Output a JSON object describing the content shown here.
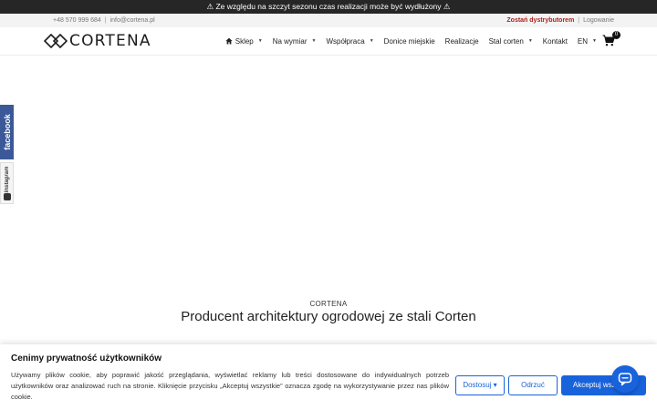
{
  "announcement": "⚠ Ze względu na szczyt sezonu czas realizacji może być wydłużony ⚠",
  "topbar": {
    "phone": "+48 570 999 684",
    "email": "info@cortena.pl",
    "separator": "|",
    "distributor": "Zostań dystrybutorem",
    "login": "Logowanie"
  },
  "logo": {
    "text": "CORTENA"
  },
  "nav": {
    "shop": "Sklep",
    "custom": "Na wymiar",
    "cooperation": "Współpraca",
    "city_planters": "Donice miejskie",
    "projects": "Realizacje",
    "corten_steel": "Stal corten",
    "contact": "Kontakt",
    "language": "EN",
    "cart_count": "0",
    "caret": "▼"
  },
  "social": {
    "facebook": "facebook",
    "instagram": "Instagram"
  },
  "hero": {
    "kicker": "CORTENA",
    "title": "Producent architektury ogrodowej ze stali Corten"
  },
  "cookie": {
    "title": "Cenimy prywatność użytkowników",
    "text": "Używamy plików cookie, aby poprawić jakość przeglądania, wyświetlać reklamy lub treści dostosowane do indywidualnych potrzeb użytkowników oraz analizować ruch na stronie. Kliknięcie przycisku „Akceptuj wszystkie” oznacza zgodę na wykorzystywanie przez nas plików cookie.",
    "customize": "Dostosuj ▾",
    "reject": "Odrzuć",
    "accept": "Akceptuj wszystkie"
  },
  "colors": {
    "accent": "#1863dc",
    "distributor": "#b11e1e",
    "facebook": "#3b5998",
    "announce_bg": "#262626"
  }
}
